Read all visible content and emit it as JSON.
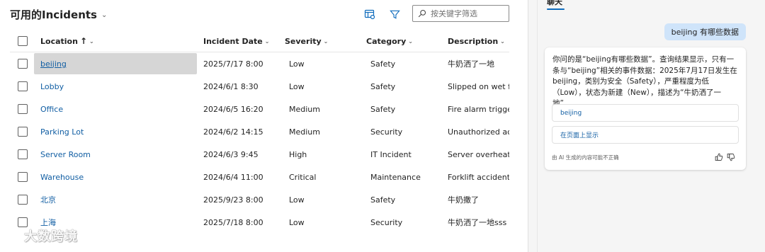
{
  "view": {
    "title": "可用的Incidents"
  },
  "search": {
    "placeholder": "按关键字筛选"
  },
  "columns": {
    "location": "Location",
    "location_sort": "↑",
    "date": "Incident Date",
    "severity": "Severity",
    "category": "Category",
    "description": "Description"
  },
  "rows": [
    {
      "location": "beijing",
      "date": "2025/7/17 8:00",
      "severity": "Low",
      "category": "Safety",
      "description": "牛奶洒了一地",
      "selected": true
    },
    {
      "location": "Lobby",
      "date": "2024/6/1 8:30",
      "severity": "Low",
      "category": "Safety",
      "description": "Slipped on wet flo"
    },
    {
      "location": "Office",
      "date": "2024/6/5 16:20",
      "severity": "Medium",
      "category": "Safety",
      "description": "Fire alarm triggere"
    },
    {
      "location": "Parking Lot",
      "date": "2024/6/2 14:15",
      "severity": "Medium",
      "category": "Security",
      "description": "Unauthorized acc..."
    },
    {
      "location": "Server Room",
      "date": "2024/6/3 9:45",
      "severity": "High",
      "category": "IT Incident",
      "description": "Server overheating"
    },
    {
      "location": "Warehouse",
      "date": "2024/6/4 11:00",
      "severity": "Critical",
      "category": "Maintenance",
      "description": "Forklift accident"
    },
    {
      "location": "北京",
      "date": "2025/9/23 8:00",
      "severity": "Low",
      "category": "Safety",
      "description": "牛奶撒了"
    },
    {
      "location": "上海",
      "date": "2025/7/18 8:00",
      "severity": "Low",
      "category": "Security",
      "description": "牛奶洒了一地sss"
    }
  ],
  "chat": {
    "tab_label": "聊天",
    "user_message": "beijing 有哪些数据",
    "bot_message": "你问的是“beijing有哪些数据”。查询结果显示，只有一条与“beijing”相关的事件数据：2025年7月17日发生在beijing，类别为安全（Safety），严重程度为低（Low），状态为新建（New），描述为“牛奶洒了一地”。",
    "reference_1": "beijing",
    "reference_2": "在页面上显示",
    "disclaimer": "由 AI 生成的内容可能不正确"
  },
  "watermark": "大数跨境",
  "icons": {
    "toolbar": [
      "edit-columns-icon",
      "filter-icon",
      "search-icon"
    ],
    "feedback": [
      "thumbs-up-icon",
      "thumbs-down-icon"
    ]
  },
  "colors": {
    "link": "#115ea3",
    "accent": "#0f6cbd",
    "user_bubble": "#cfe4fa",
    "selected_row": "#d6d6d6"
  }
}
